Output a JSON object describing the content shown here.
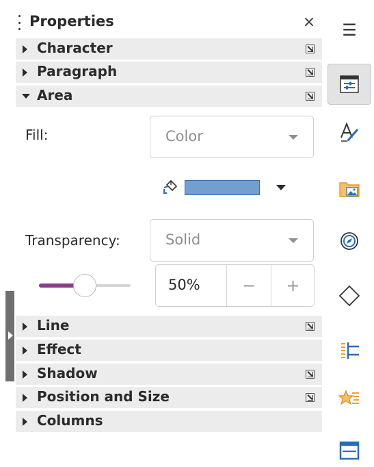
{
  "panel": {
    "title": "Properties",
    "close_glyph": "×",
    "menu_glyph": "☰"
  },
  "sections": {
    "character": {
      "label": "Character",
      "expanded": false
    },
    "paragraph": {
      "label": "Paragraph",
      "expanded": false
    },
    "area": {
      "label": "Area",
      "expanded": true
    },
    "line": {
      "label": "Line",
      "expanded": false
    },
    "effect": {
      "label": "Effect",
      "expanded": false
    },
    "shadow": {
      "label": "Shadow",
      "expanded": false
    },
    "position_size": {
      "label": "Position and Size",
      "expanded": false
    },
    "columns": {
      "label": "Columns",
      "expanded": false
    }
  },
  "area": {
    "fill_label": "Fill:",
    "fill_value": "Color",
    "fill_color": "#729fcf",
    "transparency_label": "Transparency:",
    "transparency_mode": "Solid",
    "transparency_percent": "50%",
    "transparency_fraction": 0.5,
    "minus_glyph": "−",
    "plus_glyph": "+"
  },
  "tabs": [
    {
      "icon": "properties-icon",
      "active": true
    },
    {
      "icon": "styles-icon",
      "active": false
    },
    {
      "icon": "gallery-icon",
      "active": false
    },
    {
      "icon": "navigator-icon",
      "active": false
    },
    {
      "icon": "shapes-icon",
      "active": false
    },
    {
      "icon": "page-icon",
      "active": false
    },
    {
      "icon": "style-inspector-icon",
      "active": false
    },
    {
      "icon": "manage-changes-icon",
      "active": false
    }
  ],
  "colors": {
    "accent_purple": "#8a3d88",
    "section_bg": "#ececec",
    "icon_blue": "#2a6cb8",
    "icon_orange": "#f0a030"
  }
}
